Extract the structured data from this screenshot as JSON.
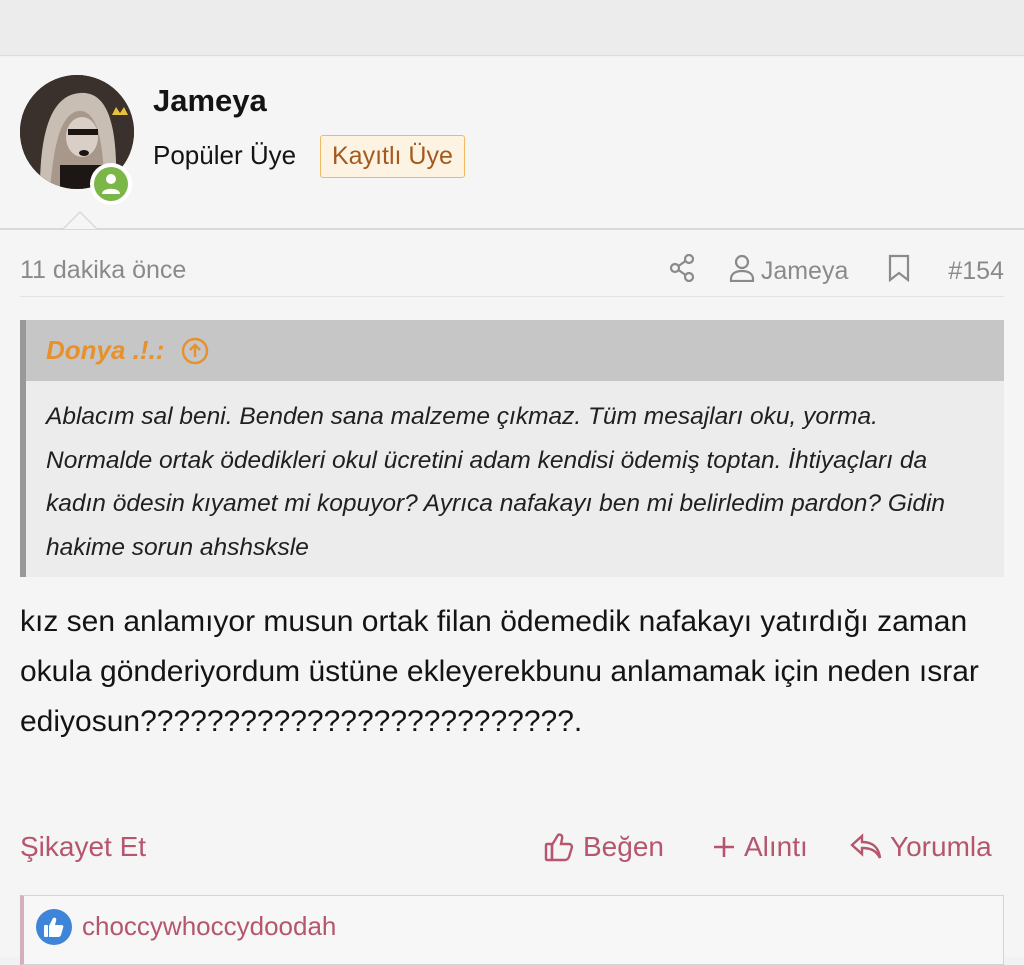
{
  "author": {
    "username": "Jameya",
    "title": "Popüler Üye",
    "badge": "Kayıtlı Üye",
    "online_color": "#7ab648"
  },
  "meta": {
    "time": "11 dakika önce",
    "share_icon": "share-icon",
    "author": "Jameya",
    "post_number": "#154"
  },
  "quote": {
    "author": "Donya .!.:",
    "text": "Ablacım sal beni. Benden sana malzeme çıkmaz. Tüm mesajları oku, yorma. Normalde ortak ödedikleri okul ücretini adam kendisi ödemiş toptan. İhtiyaçları da kadın ödesin kıyamet mi kopuyor? Ayrıca nafakayı ben mi belirledim pardon? Gidin hakime sorun ahshsksle"
  },
  "message": {
    "text": "kız sen anlamıyor musun ortak filan ödemedik nafakayı yatırdığı zaman okula gönderiyordum üstüne ekleyerekbunu anlamamak için neden ısrar ediyosun??????????????????????????."
  },
  "actions": {
    "report": "Şikayet Et",
    "like": "Beğen",
    "quote": "Alıntı",
    "reply": "Yorumla"
  },
  "reactions": {
    "user": "choccywhoccydoodah",
    "icon": "thumbs-up-icon"
  },
  "colors": {
    "accent": "#b5566e",
    "quote_author": "#e6912b",
    "badge_text": "#a35a1e",
    "badge_border": "#f0b964",
    "reaction_blue": "#3e84d8"
  }
}
